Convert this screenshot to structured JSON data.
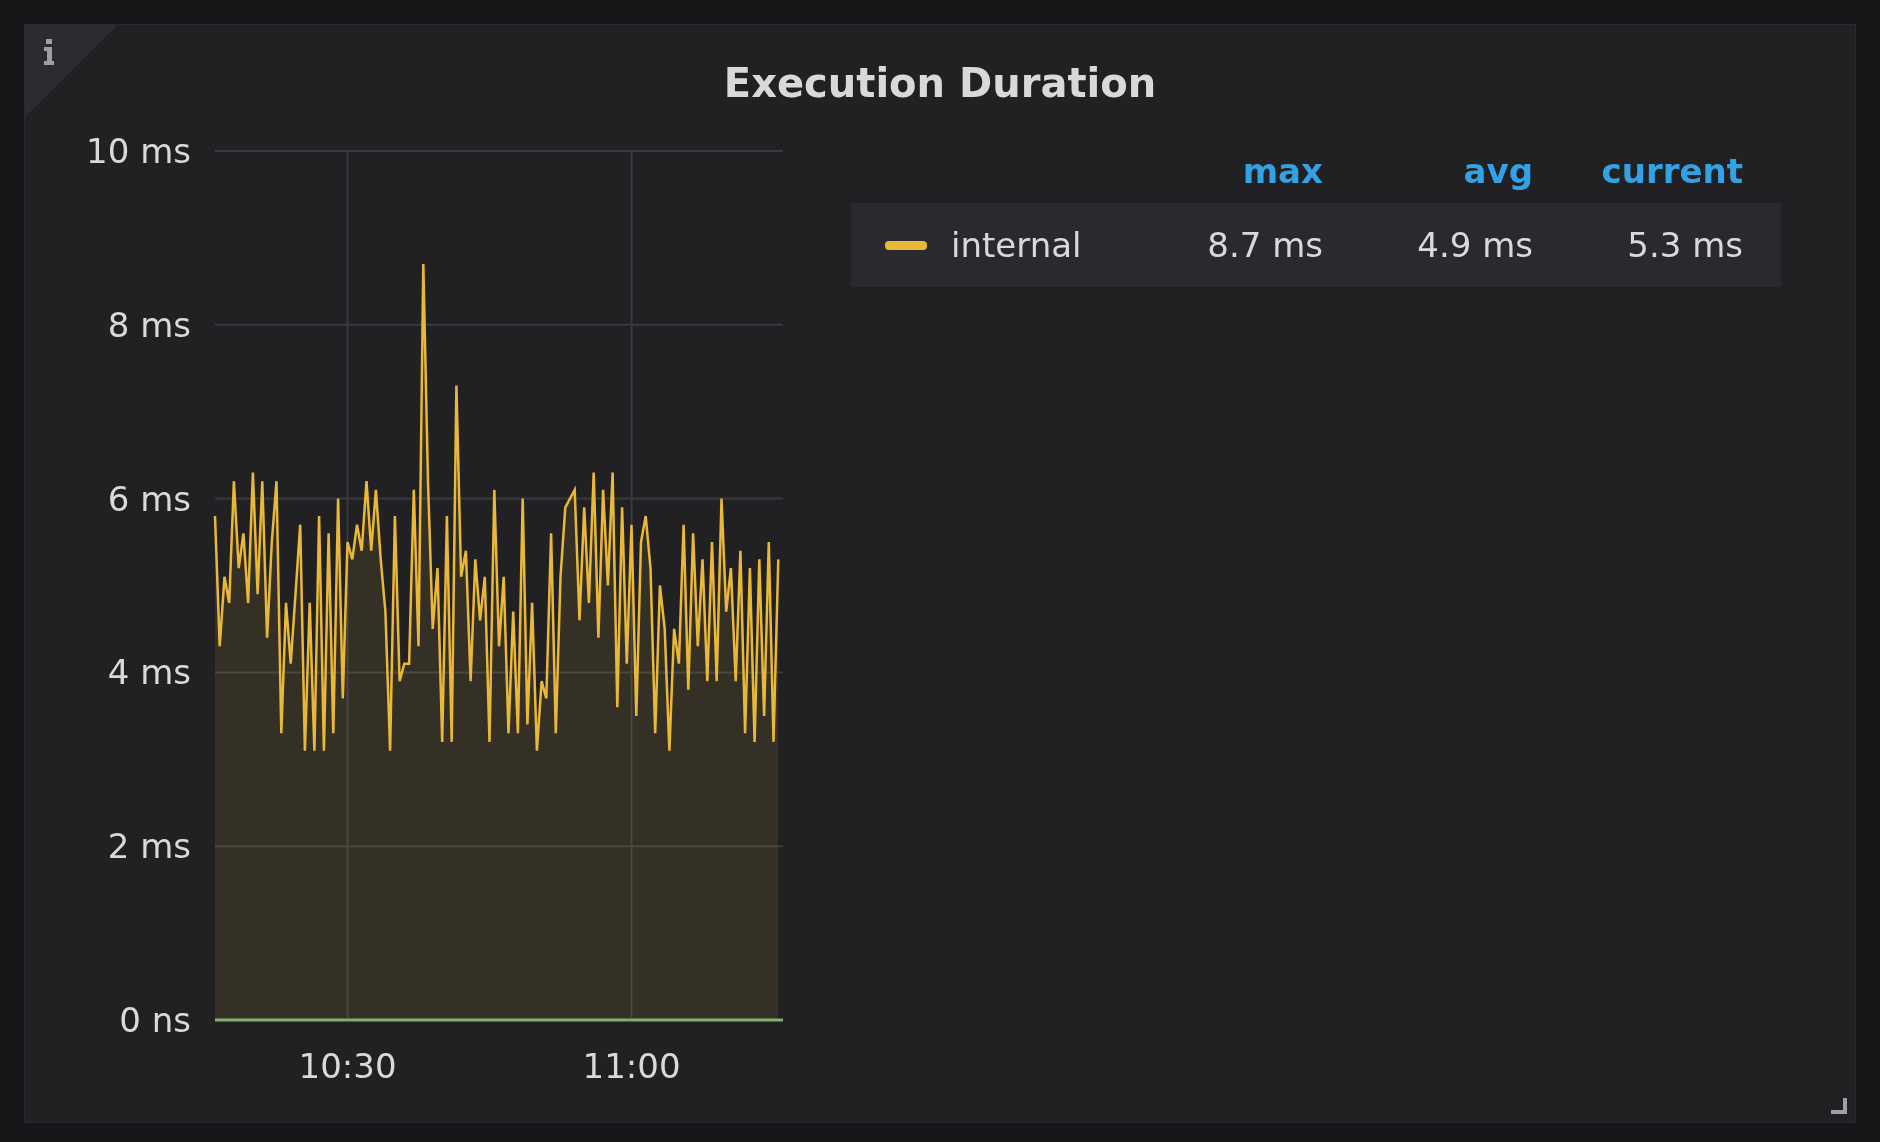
{
  "panel": {
    "title": "Execution Duration",
    "chart_data": {
      "type": "area",
      "categories": [
        null,
        null,
        null,
        null,
        null,
        null,
        null,
        null,
        null,
        null,
        null,
        null,
        null,
        null,
        null,
        null,
        null,
        null,
        null,
        null,
        null,
        null,
        null,
        null,
        null,
        null,
        null,
        null,
        "10:30",
        null,
        null,
        null,
        null,
        null,
        null,
        null,
        null,
        null,
        null,
        null,
        null,
        null,
        null,
        null,
        null,
        null,
        null,
        null,
        null,
        null,
        null,
        null,
        null,
        null,
        null,
        null,
        null,
        null,
        null,
        null,
        null,
        null,
        null,
        null,
        null,
        null,
        null,
        null,
        null,
        null,
        null,
        null,
        null,
        null,
        null,
        null,
        null,
        null,
        null,
        null,
        null,
        null,
        null,
        null,
        null,
        null,
        null,
        null,
        "11:00",
        null,
        null,
        null,
        null,
        null,
        null,
        null,
        null,
        null,
        null,
        null,
        null,
        null,
        null,
        null,
        null,
        null,
        null,
        null,
        null,
        null,
        null,
        null,
        null,
        null,
        null,
        null,
        null,
        null,
        null,
        null
      ],
      "series": [
        {
          "name": "internal",
          "color": "#eab839",
          "values": [
            5.8,
            4.3,
            5.1,
            4.8,
            6.2,
            5.2,
            5.6,
            4.8,
            6.3,
            4.9,
            6.2,
            4.4,
            5.5,
            6.2,
            3.3,
            4.8,
            4.1,
            4.9,
            5.7,
            3.1,
            4.8,
            3.1,
            5.8,
            3.1,
            5.6,
            3.3,
            6.0,
            3.7,
            5.5,
            5.3,
            5.7,
            5.4,
            6.2,
            5.4,
            6.1,
            5.3,
            4.7,
            3.1,
            5.8,
            3.9,
            4.1,
            4.1,
            6.1,
            4.3,
            8.7,
            6.2,
            4.5,
            5.2,
            3.2,
            5.8,
            3.2,
            7.3,
            5.1,
            5.4,
            3.9,
            5.3,
            4.6,
            5.1,
            3.2,
            6.1,
            4.3,
            5.1,
            3.3,
            4.7,
            3.3,
            6.0,
            3.4,
            4.8,
            3.1,
            3.9,
            3.7,
            5.6,
            3.3,
            5.1,
            5.9,
            6.0,
            6.1,
            4.6,
            5.9,
            4.8,
            6.3,
            4.4,
            6.1,
            5.0,
            6.3,
            3.6,
            5.9,
            4.1,
            5.7,
            3.5,
            5.5,
            5.8,
            5.2,
            3.3,
            5.0,
            4.5,
            3.1,
            4.5,
            4.1,
            5.7,
            3.8,
            5.6,
            4.3,
            5.3,
            3.9,
            5.5,
            3.9,
            6.0,
            4.7,
            5.2,
            3.9,
            5.4,
            3.3,
            5.2,
            3.2,
            5.3,
            3.5,
            5.5,
            3.2,
            5.3
          ]
        }
      ],
      "grid": true,
      "ylim": [
        0,
        10
      ],
      "yticks": [
        {
          "value": 0,
          "label": "0 ns"
        },
        {
          "value": 2,
          "label": "2 ms"
        },
        {
          "value": 4,
          "label": "4 ms"
        },
        {
          "value": 6,
          "label": "6 ms"
        },
        {
          "value": 8,
          "label": "8 ms"
        },
        {
          "value": 10,
          "label": "10 ms"
        }
      ]
    },
    "legend": {
      "headers": [
        "max",
        "avg",
        "current"
      ],
      "values": [
        "8.7 ms",
        "4.9 ms",
        "5.3 ms"
      ]
    }
  }
}
